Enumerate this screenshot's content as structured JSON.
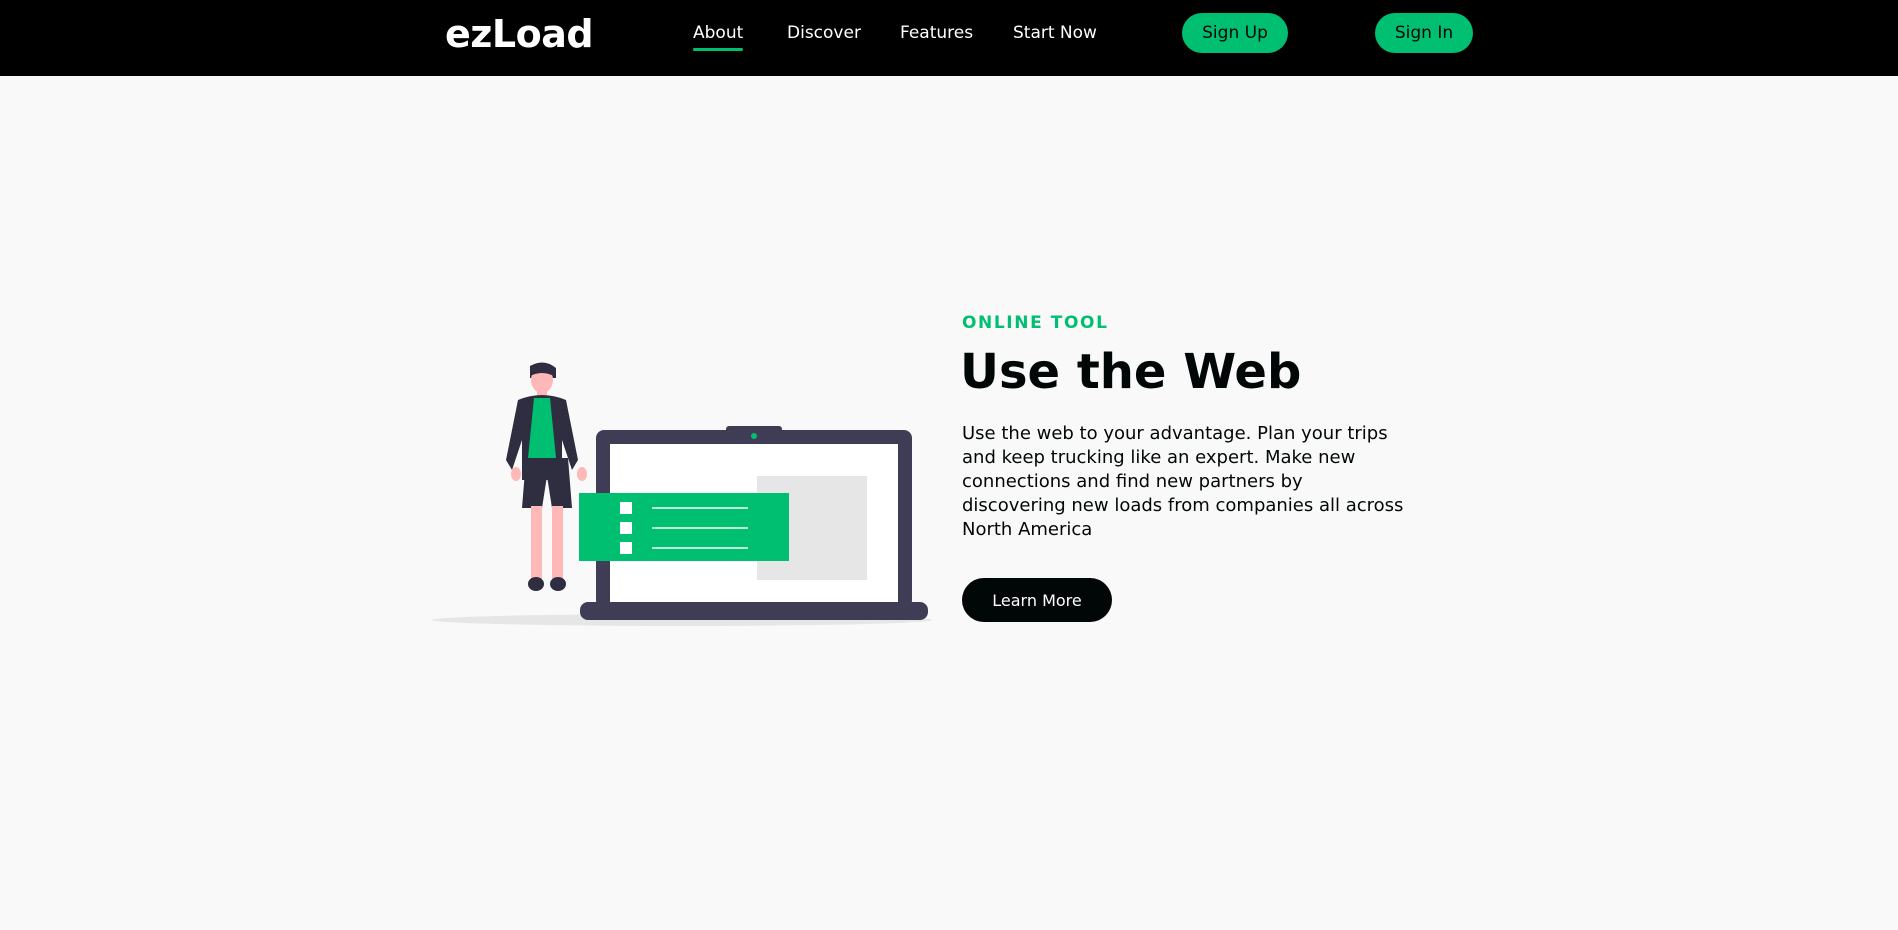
{
  "nav": {
    "logo": "ezLoad",
    "links": [
      {
        "label": "About",
        "active": true
      },
      {
        "label": "Discover",
        "active": false
      },
      {
        "label": "Features",
        "active": false
      },
      {
        "label": "Start Now",
        "active": false
      }
    ],
    "sign_up_label": "Sign Up",
    "sign_in_label": "Sign In"
  },
  "hero": {
    "eyebrow": "ONLINE TOOL",
    "headline": "Use the Web",
    "description": "Use the web to your advantage. Plan your trips and keep trucking like an expert. Make new connections and find new partners by discovering new loads from companies all across North America",
    "button_label": "Learn More"
  },
  "colors": {
    "accent": "#01bf71",
    "nav_background": "#000000",
    "page_background": "#f9f9f9",
    "text_dark": "#010606",
    "laptop_frame": "#3f3d56"
  },
  "icons": {
    "illustration": "person-with-laptop-illustration"
  }
}
